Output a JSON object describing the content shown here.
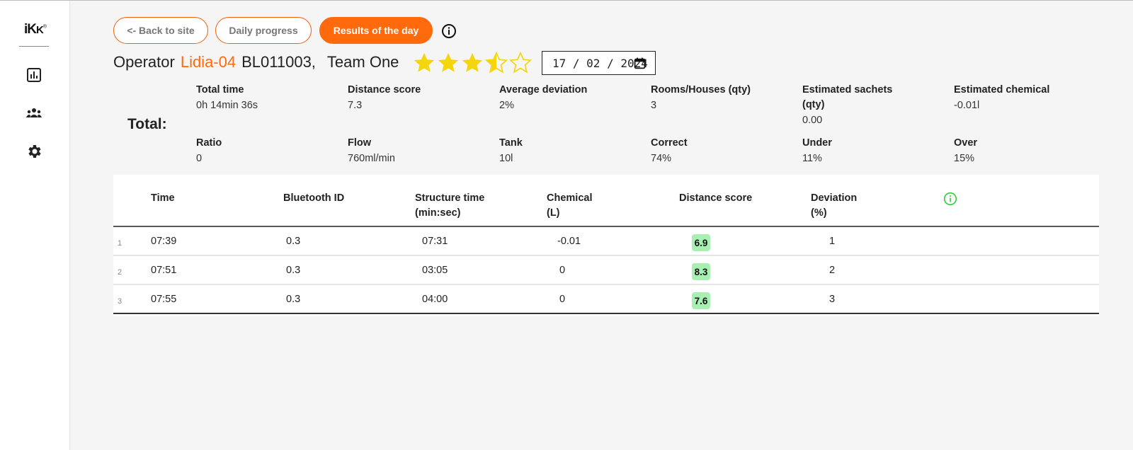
{
  "sidebar": {
    "logo": "iK",
    "logo_mark": "®",
    "items": [
      {
        "icon": "bar-chart-icon"
      },
      {
        "icon": "team-icon"
      },
      {
        "icon": "gear-icon"
      }
    ]
  },
  "nav": {
    "back_label": "<- Back to site",
    "daily_label": "Daily progress",
    "results_label": "Results of the day",
    "info_icon": "info-icon"
  },
  "operator": {
    "prefix": "Operator",
    "name": "Lidia-04",
    "code": "BL011003,",
    "team": "Team One",
    "rating": 3.5,
    "rating_max": 5,
    "date": "17 / 02 / 2024"
  },
  "totals": {
    "label": "Total:",
    "stats": [
      {
        "label": "Total time",
        "value": "0h 14min 36s"
      },
      {
        "label": "Distance score",
        "value": "7.3"
      },
      {
        "label": "Average deviation",
        "value": "2%"
      },
      {
        "label": "Rooms/Houses (qty)",
        "value": "3"
      },
      {
        "label": "Estimated sachets (qty)",
        "value": "0.00"
      },
      {
        "label": "Estimated chemical",
        "value": "-0.01l"
      },
      {
        "label": "Ratio",
        "value": "0"
      },
      {
        "label": "Flow",
        "value": "760ml/min"
      },
      {
        "label": "Tank",
        "value": "10l"
      },
      {
        "label": "Correct",
        "value": "74%"
      },
      {
        "label": "Under",
        "value": "11%"
      },
      {
        "label": "Over",
        "value": "15%"
      }
    ]
  },
  "table": {
    "headers": [
      "Time",
      "Bluetooth ID",
      "Structure time (min:sec)",
      "Chemical (L)",
      "Distance score",
      "Deviation (%)"
    ],
    "rows": [
      {
        "idx": "1",
        "time": "07:39",
        "bt": "0.3",
        "structure": "07:31",
        "chemical": "-0.01",
        "score": "6.9",
        "deviation": "1"
      },
      {
        "idx": "2",
        "time": "07:51",
        "bt": "0.3",
        "structure": "03:05",
        "chemical": "0",
        "score": "8.3",
        "deviation": "2"
      },
      {
        "idx": "3",
        "time": "07:55",
        "bt": "0.3",
        "structure": "04:00",
        "chemical": "0",
        "score": "7.6",
        "deviation": "3"
      }
    ]
  },
  "colors": {
    "accent": "#ff6a0d",
    "star": "#f5d60c",
    "badge": "#a8f0b2",
    "info_green": "#2ecc40"
  }
}
